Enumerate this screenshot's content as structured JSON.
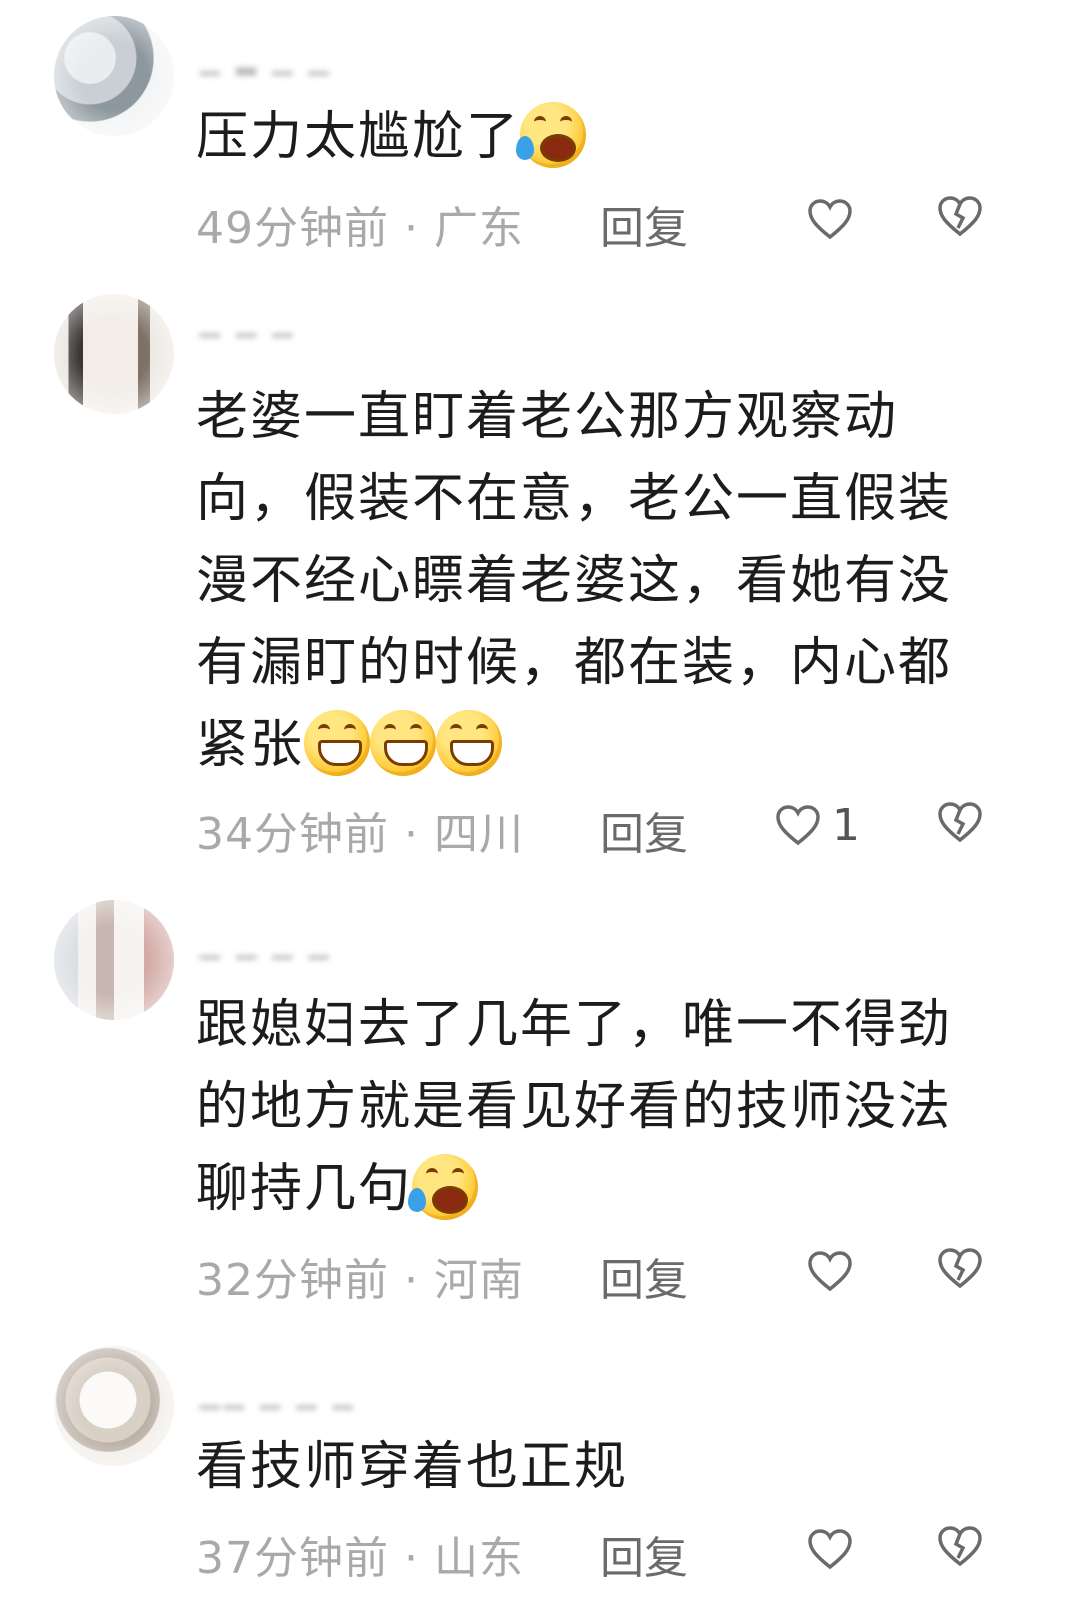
{
  "comments": [
    {
      "text": "压力太尴尬了",
      "emojis": [
        "tears-of-joy-emoji"
      ],
      "time_location": "49分钟前 · 广东",
      "reply_label": "回复",
      "like_count": ""
    },
    {
      "text": "老婆一直盯着老公那方观察动向，假装不在意，老公一直假装漫不经心瞟着老婆这，看她有没有漏盯的时候，都在装，内心都紧张",
      "emojis": [
        "grin-emoji",
        "grin-emoji",
        "grin-emoji"
      ],
      "time_location": "34分钟前 · 四川",
      "reply_label": "回复",
      "like_count": "1"
    },
    {
      "text": "跟媳妇去了几年了，唯一不得劲的地方就是看见好看的技师没法聊持几句",
      "emojis": [
        "tears-of-joy-emoji"
      ],
      "time_location": "32分钟前 · 河南",
      "reply_label": "回复",
      "like_count": ""
    },
    {
      "text": "看技师穿着也正规",
      "emojis": [],
      "time_location": "37分钟前 · 山东",
      "reply_label": "回复",
      "like_count": ""
    }
  ],
  "icons": {
    "like": "heart-outline-icon",
    "dislike": "broken-heart-icon"
  },
  "colors": {
    "text": "#1c1c1c",
    "meta": "#a9a9a9",
    "reply": "#6a6a6a"
  }
}
